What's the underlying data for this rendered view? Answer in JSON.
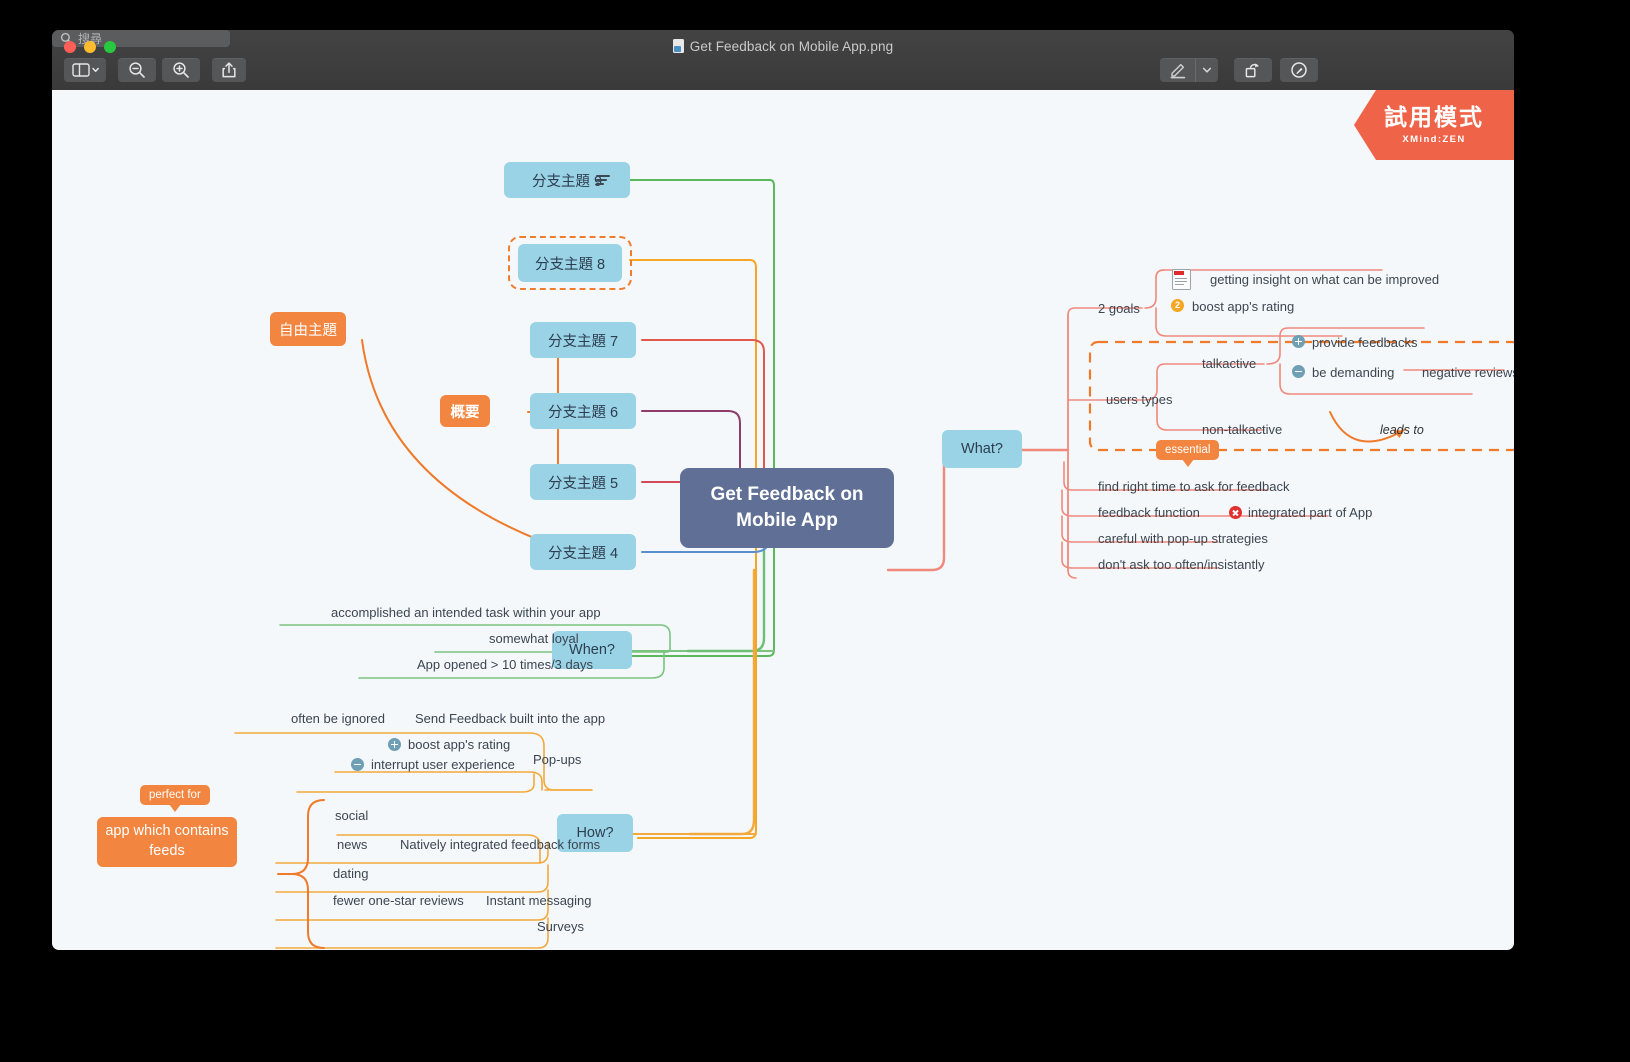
{
  "window": {
    "title": "Get Feedback on  Mobile App.png",
    "file_icon": "png-file-icon",
    "traffic_lights": [
      "close-red",
      "minimize-yellow",
      "zoom-green"
    ]
  },
  "toolbar": {
    "sidebar_button": "sidebar-icon",
    "zoom_out_button": "zoom-out-icon",
    "zoom_in_button": "zoom-in-icon",
    "share_button": "share-icon",
    "markup_button": "markup-pen-icon",
    "markup_dropdown": "chevron-down-icon",
    "rotate_button": "rotate-icon",
    "annotate_button": "annotate-icon",
    "search_icon": "search-icon",
    "search_placeholder": "搜尋",
    "search_value": ""
  },
  "trial_banner": {
    "label": "試用模式",
    "product": "XMind:ZEN",
    "color": "#ef6449"
  },
  "mindmap": {
    "central_topic": "Get Feedback on\nMobile App",
    "central_line1": "Get Feedback on",
    "central_line2": "Mobile App",
    "floating_topic": "自由主題",
    "summary_label": "概要",
    "branch_topics": [
      {
        "label": "分支主題 9",
        "has_notes_icon": true,
        "selected": false
      },
      {
        "label": "分支主題 8",
        "has_notes_icon": false,
        "selected": true
      },
      {
        "label": "分支主題 7",
        "has_notes_icon": false,
        "selected": false
      },
      {
        "label": "分支主題 6",
        "has_notes_icon": false,
        "selected": false
      },
      {
        "label": "分支主題 5",
        "has_notes_icon": false,
        "selected": false
      },
      {
        "label": "分支主題 4",
        "has_notes_icon": false,
        "selected": false
      }
    ],
    "main_branches": [
      {
        "label": "What?",
        "color": "#f08e82"
      },
      {
        "label": "When?",
        "color": "#79c27e"
      },
      {
        "label": "How?",
        "color": "#f3a93c"
      }
    ],
    "what_branch": {
      "goals_label": "2 goals",
      "goal_1": "getting insight on what can be improved",
      "goal_1_icon": "news-icon",
      "goal_2": "boost app's rating",
      "goal_2_marker": "2",
      "users_types_label": "users types",
      "talkactive": "talkactive",
      "non_talkactive": "non-talkactive",
      "provide_feedbacks": "provide feedbacks",
      "provide_feedbacks_marker": "plus",
      "be_demanding": "be demanding",
      "be_demanding_marker": "minus",
      "negative_reviews": "negative reviews",
      "relationship_label": "leads to",
      "essential_callout": "essential",
      "items": [
        {
          "text": "find right time to ask for feedback"
        },
        {
          "text": "feedback function",
          "marker": "x",
          "extra": "integrated part of App"
        },
        {
          "text": "careful with pop-up strategies"
        },
        {
          "text": "don't ask too often/insistantly"
        }
      ]
    },
    "when_branch": {
      "items": [
        "accomplished an intended task within your app",
        "somewhat loyal",
        "App opened > 10 times/3 days"
      ]
    },
    "how_branch": {
      "send_feedback": "Send Feedback built into the app",
      "often_be_ignored": "often be ignored",
      "popups_label": "Pop-ups",
      "popups_pro": "boost app's rating",
      "popups_pro_marker": "plus",
      "popups_con": "interrupt user experience",
      "popups_con_marker": "minus",
      "natively_integrated": "Natively integrated feedback forms",
      "app_types": [
        "social",
        "news",
        "dating"
      ],
      "perfect_for_callout": "perfect for",
      "perfect_for_target": "app which contains feeds",
      "instant_messaging": "Instant messaging",
      "fewer_one_star": "fewer one-star reviews",
      "surveys": "Surveys"
    }
  }
}
